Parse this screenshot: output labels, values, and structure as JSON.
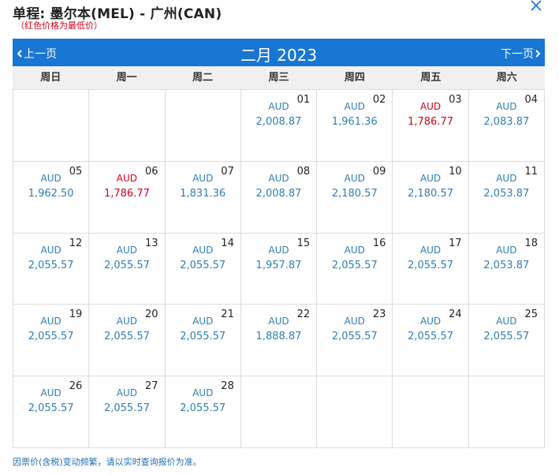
{
  "header": {
    "title": "单程: 墨尔本(MEL) - 广州(CAN)",
    "note": "（红色价格为最低价）"
  },
  "calendar": {
    "prev_label": "上一页",
    "next_label": "下一页",
    "month_label": "二月 2023",
    "weekdays": [
      "周日",
      "周一",
      "周二",
      "周三",
      "周四",
      "周五",
      "周六"
    ],
    "currency": "AUD",
    "lowest_color": "#d0021b",
    "normal_color": "#2e7fb3",
    "header_color": "#1976d2",
    "cells": [
      {
        "day": "",
        "currency": "",
        "price": "",
        "low": false
      },
      {
        "day": "",
        "currency": "",
        "price": "",
        "low": false
      },
      {
        "day": "",
        "currency": "",
        "price": "",
        "low": false
      },
      {
        "day": "01",
        "currency": "AUD",
        "price": "2,008.87",
        "low": false
      },
      {
        "day": "02",
        "currency": "AUD",
        "price": "1,961.36",
        "low": false
      },
      {
        "day": "03",
        "currency": "AUD",
        "price": "1,786.77",
        "low": true
      },
      {
        "day": "04",
        "currency": "AUD",
        "price": "2,083.87",
        "low": false
      },
      {
        "day": "05",
        "currency": "AUD",
        "price": "1,962.50",
        "low": false
      },
      {
        "day": "06",
        "currency": "AUD",
        "price": "1,786.77",
        "low": true
      },
      {
        "day": "07",
        "currency": "AUD",
        "price": "1,831.36",
        "low": false
      },
      {
        "day": "08",
        "currency": "AUD",
        "price": "2,008.87",
        "low": false
      },
      {
        "day": "09",
        "currency": "AUD",
        "price": "2,180.57",
        "low": false
      },
      {
        "day": "10",
        "currency": "AUD",
        "price": "2,180.57",
        "low": false
      },
      {
        "day": "11",
        "currency": "AUD",
        "price": "2,053.87",
        "low": false
      },
      {
        "day": "12",
        "currency": "AUD",
        "price": "2,055.57",
        "low": false
      },
      {
        "day": "13",
        "currency": "AUD",
        "price": "2,055.57",
        "low": false
      },
      {
        "day": "14",
        "currency": "AUD",
        "price": "2,055.57",
        "low": false
      },
      {
        "day": "15",
        "currency": "AUD",
        "price": "1,957.87",
        "low": false
      },
      {
        "day": "16",
        "currency": "AUD",
        "price": "2,055.57",
        "low": false
      },
      {
        "day": "17",
        "currency": "AUD",
        "price": "2,055.57",
        "low": false
      },
      {
        "day": "18",
        "currency": "AUD",
        "price": "2,053.87",
        "low": false
      },
      {
        "day": "19",
        "currency": "AUD",
        "price": "2,055.57",
        "low": false
      },
      {
        "day": "20",
        "currency": "AUD",
        "price": "2,055.57",
        "low": false
      },
      {
        "day": "21",
        "currency": "AUD",
        "price": "2,055.57",
        "low": false
      },
      {
        "day": "22",
        "currency": "AUD",
        "price": "1,888.87",
        "low": false
      },
      {
        "day": "23",
        "currency": "AUD",
        "price": "2,055.57",
        "low": false
      },
      {
        "day": "24",
        "currency": "AUD",
        "price": "2,055.57",
        "low": false
      },
      {
        "day": "25",
        "currency": "AUD",
        "price": "2,055.57",
        "low": false
      },
      {
        "day": "26",
        "currency": "AUD",
        "price": "2,055.57",
        "low": false
      },
      {
        "day": "27",
        "currency": "AUD",
        "price": "2,055.57",
        "low": false
      },
      {
        "day": "28",
        "currency": "AUD",
        "price": "2,055.57",
        "low": false
      },
      {
        "day": "",
        "currency": "",
        "price": "",
        "low": false
      },
      {
        "day": "",
        "currency": "",
        "price": "",
        "low": false
      },
      {
        "day": "",
        "currency": "",
        "price": "",
        "low": false
      },
      {
        "day": "",
        "currency": "",
        "price": "",
        "low": false
      }
    ]
  },
  "footer": {
    "disclaimer": "因票价(含税)变动频繁，请以实时查询报价为准。"
  },
  "icons": {
    "close": "close-icon",
    "prev": "chevron-left-icon",
    "next": "chevron-right-icon"
  }
}
